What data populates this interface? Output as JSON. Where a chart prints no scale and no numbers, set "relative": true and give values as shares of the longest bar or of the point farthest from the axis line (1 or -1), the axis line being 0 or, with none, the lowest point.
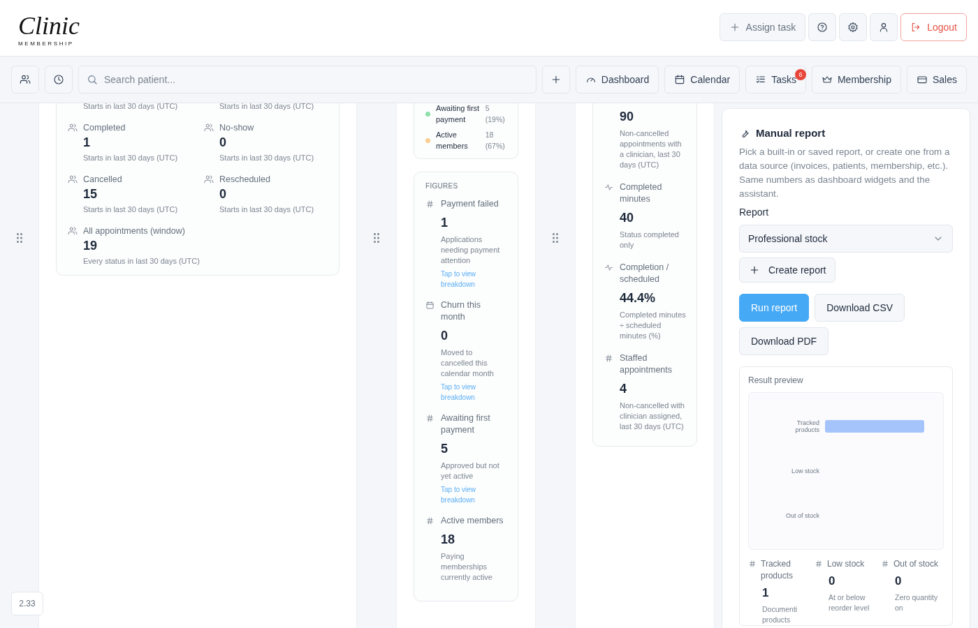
{
  "header": {
    "logo": {
      "script": "Clinic",
      "tagline": "MEMBERSHIP"
    },
    "assign_button": "Assign task",
    "icon_buttons": [
      {
        "kind": "help"
      },
      {
        "kind": "settings"
      },
      {
        "kind": "user"
      }
    ],
    "logout_button": "Logout"
  },
  "toolbar": {
    "icon_buttons": [
      {
        "kind": "people"
      },
      {
        "kind": "clock"
      }
    ],
    "search": {
      "placeholder": "Search patient..."
    },
    "nav": [
      {
        "label": "Dashboard",
        "kind": "gauge"
      },
      {
        "label": "Calendar",
        "kind": "calendar"
      },
      {
        "label": "Tasks",
        "kind": "tasks",
        "badge": "6"
      },
      {
        "label": "Membership",
        "kind": "crown"
      },
      {
        "label": "Sales",
        "kind": "card"
      }
    ]
  },
  "appointments": {
    "top_notes": [
      "Starts in last 30 days (UTC)",
      "Starts in last 30 days (UTC)"
    ],
    "metrics": [
      {
        "label": "Completed",
        "value": "1",
        "note": "Starts in last 30 days (UTC)"
      },
      {
        "label": "No-show",
        "value": "0",
        "note": "Starts in last 30 days (UTC)"
      },
      {
        "label": "Cancelled",
        "value": "15",
        "note": "Starts in last 30 days (UTC)"
      },
      {
        "label": "Rescheduled",
        "value": "0",
        "note": "Starts in last 30 days (UTC)"
      },
      {
        "label": "All appointments (window)",
        "value": "19",
        "note": "Every status in last 30 days (UTC)"
      }
    ]
  },
  "membership": {
    "legend": [
      {
        "label": "Awaiting first payment",
        "value": "5",
        "share": "(19%)",
        "color": "#8fe0a8"
      },
      {
        "label": "Active members",
        "value": "18",
        "share": "(67%)",
        "color": "#fbcf8f"
      }
    ],
    "figures_title": "FIGURES",
    "figures": [
      {
        "kind": "count",
        "label": "Payment failed",
        "value": "1",
        "note": "Applications needing payment attention",
        "link": "Tap to view breakdown"
      },
      {
        "kind": "calendar",
        "label": "Churn this month",
        "value": "0",
        "note": "Moved to cancelled this calendar month",
        "link": "Tap to view breakdown"
      },
      {
        "kind": "count",
        "label": "Awaiting first payment",
        "value": "5",
        "note": "Approved but not yet active",
        "link": "Tap to view breakdown"
      },
      {
        "kind": "count",
        "label": "Active members",
        "value": "18",
        "note": "Paying memberships currently active"
      }
    ]
  },
  "clinician": {
    "metrics": [
      {
        "kind": "none",
        "value": "90",
        "note": "Non-cancelled appointments with a clinician, last 30 days (UTC)"
      },
      {
        "kind": "activity",
        "label": "Completed minutes",
        "value": "40",
        "note": "Status completed only"
      },
      {
        "kind": "activity",
        "label": "Completion / scheduled",
        "value": "44.4%",
        "note": "Completed minutes ÷ scheduled minutes (%)"
      },
      {
        "kind": "count",
        "label": "Staffed appointments",
        "value": "4",
        "note": "Non-cancelled with clinician assigned, last 30 days (UTC)"
      }
    ]
  },
  "manual_report": {
    "title": "Manual report",
    "description": "Pick a built-in or saved report, or create one from a data source (invoices, patients, membership, etc.). Same numbers as dashboard widgets and the assistant.",
    "report_label": "Report",
    "report_select": "Professional stock",
    "create_button": "Create report",
    "actions": [
      {
        "label": "Run report",
        "kind": "primary"
      },
      {
        "label": "Download CSV",
        "kind": "secondary"
      },
      {
        "label": "Download PDF",
        "kind": "secondary"
      }
    ],
    "preview": {
      "title": "Result preview",
      "chart_data": {
        "type": "bar",
        "orientation": "horizontal",
        "relative": true,
        "categories": [
          "Tracked products",
          "Low stock",
          "Out of stock"
        ],
        "values": [
          1,
          0,
          0
        ]
      },
      "stats": [
        {
          "label": "Tracked products",
          "value": "1",
          "note": "Documenti products"
        },
        {
          "label": "Low stock",
          "value": "0",
          "note": "At or below reorder level"
        },
        {
          "label": "Out of stock",
          "value": "0",
          "note": "Zero quantity on"
        }
      ]
    }
  },
  "version": "2.33"
}
